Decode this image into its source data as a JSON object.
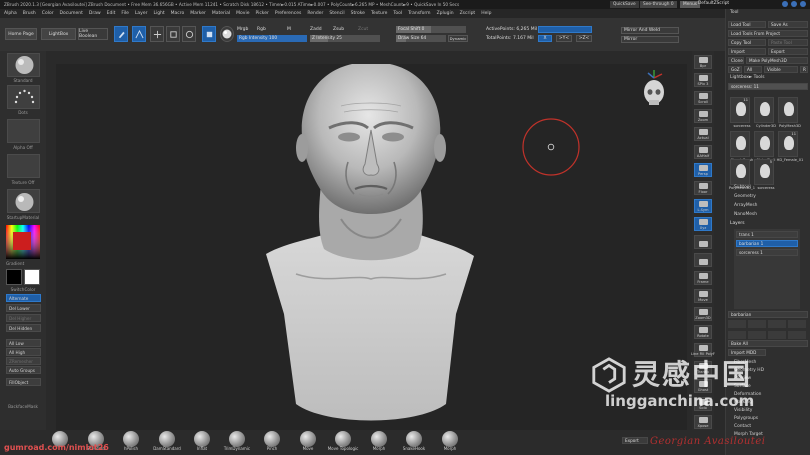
{
  "titlebar": {
    "text": "ZBrush 2020.1.3 [Georgian Avasiloutei]   ZBrush Document   • Free Mem 36.656GB • Active Mem 11241 • Scratch Disk 18612 • Timer►0.015 ATime►0.007 • PolyCount►6.265 MP • MeshCount►9   • QuickSave In 50 Secs",
    "quicksave": "QuickSave",
    "see_through": "See-through  0",
    "menus": "Menus",
    "default_zscript": "DefaultZScript"
  },
  "menubar": [
    "Alpha",
    "Brush",
    "Color",
    "Document",
    "Draw",
    "Edit",
    "File",
    "Layer",
    "Light",
    "Macro",
    "Marker",
    "Material",
    "Movie",
    "Picker",
    "Preferences",
    "Render",
    "Stencil",
    "Stroke",
    "Texture",
    "Tool",
    "Transform",
    "Zplugin",
    "Zscript",
    "Help"
  ],
  "toolbar": {
    "home_page": "Home Page",
    "lightbox": "LightBox",
    "live_boolean": "Live Boolean",
    "edit": "Edit",
    "draw": "Draw",
    "move": "Move",
    "scale": "Scale",
    "rotate": "Rotate",
    "mrgb": "Mrgb",
    "rgb": "Rgb",
    "m": "M",
    "rgb_intensity": "Rgb Intensity 100",
    "zadd": "Zadd",
    "zsub": "Zsub",
    "zcut": "Zcut",
    "z_intensity": "Z Intensity 25",
    "focal_shift": "Focal Shift 0",
    "draw_size": "Draw Size 64",
    "dynamic": "Dynamic",
    "active_points": "ActivePoints: 6,265 Mil",
    "total_points": "TotalPoints: 7.167 Mil",
    "mirror_and_weld": "Mirror And Weld",
    "mirror": "Mirror",
    "x_axis": "X",
    "y_axis": ">Y<",
    "z_axis": ">Z<"
  },
  "leftshelf": {
    "standard": "Standard",
    "dots": "Dots",
    "alpha_off": "Alpha Off",
    "texture_off": "Texture Off",
    "startup_material": "StartupMaterial",
    "gradient": "Gradient",
    "switch_color": "SwitchColor",
    "alternate": "Alternate",
    "del_lower": "Del Lower",
    "del_higher": "Del Higher",
    "del_hidden": "Del Hidden",
    "all_low": "All Low",
    "all_high": "All High",
    "zremesher": "ZRemesher",
    "auto_groups": "Auto Groups",
    "fill_object": "FillObject",
    "backface_mask": "BackfaceMask"
  },
  "rightstrip": [
    "Bpr",
    "SPix 3",
    "Scroll",
    "Zoom",
    "Actual",
    "AAHalf",
    "Persp",
    "Floor",
    "L.Sym",
    "Xyz",
    "",
    "",
    "Frame",
    "Move",
    "Zoom3D",
    "Rotate",
    "Line Fill PolyF",
    "Transp",
    "Ghost",
    "Solo",
    "Xpose"
  ],
  "toolpanel": {
    "tool_title": "Tool",
    "load_tool": "Load Tool",
    "save_as": "Save As",
    "load_from_project": "Load Tools From Project",
    "copy_tool": "Copy Tool",
    "paste_tool": "Paste Tool",
    "import": "Import",
    "export": "Export",
    "clone": "Clone",
    "make_polymesh": "Make PolyMesh3D",
    "goz": "GoZ",
    "all": "All",
    "visible": "Visible",
    "r": "R",
    "lightbox_tools": "Lightbox► Tools",
    "tool_name": "sorceress: 11",
    "tools": [
      {
        "name": "sorceress",
        "count": "11"
      },
      {
        "name": "Cylinder3D",
        "count": ""
      },
      {
        "name": "PolyMesh3D",
        "count": ""
      },
      {
        "name": "SimpleBrush",
        "count": ""
      },
      {
        "name": "Male_Skull",
        "count": ""
      },
      {
        "name": "HD_Female_01",
        "count": "11"
      },
      {
        "name": "PolyMesh3D_1",
        "count": ""
      },
      {
        "name": "sorceress",
        "count": "5"
      }
    ],
    "subtool": "Subtool",
    "geometry": "Geometry",
    "arraymesh": "ArrayMesh",
    "nanomesh": "NanoMesh",
    "layers": "Layers",
    "layer_items": [
      "trans 1",
      "barbarian 1",
      "sorceress 1"
    ],
    "layer_name": "barbarian",
    "bake_all": "Bake All",
    "import_mdd": "Import MDD",
    "fibermesh": "FiberMesh",
    "geometry_hd": "Geometry HD",
    "preview": "Preview",
    "surface": "Surface",
    "deformation": "Deformation",
    "masking": "Masking",
    "visibility": "Visibility",
    "polygroups": "Polygroups",
    "contact": "Contact",
    "morph_target": "Morph Target",
    "export_btn": "Export"
  },
  "bottombar": [
    "ClayBuildup",
    "Standard",
    "hPolish",
    "DamStandard",
    "Inflat",
    "TrimDynamic",
    "Pinch",
    "Move",
    "Move Topologic",
    "Morph",
    "SnakeHook",
    "Morph"
  ],
  "overlay": {
    "gumroad": "gumroad.com/nimlot26",
    "signature": "Georgian Avasiloutei",
    "watermark_cn": "灵感中国",
    "watermark_url": "lingganchina.com"
  },
  "colors": {
    "accent_blue": "#1f5fa8",
    "viewport_bg": "#252525",
    "cursor_ring": "#c0322a"
  }
}
